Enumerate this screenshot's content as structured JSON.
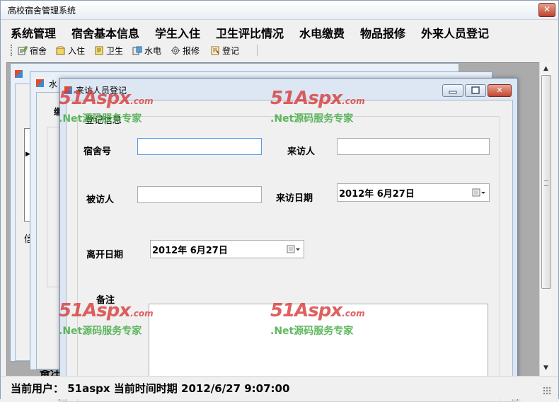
{
  "app": {
    "title": "高校宿舍管理系统",
    "close_glyph": "✕"
  },
  "menu": {
    "items": [
      {
        "label": "系统管理"
      },
      {
        "label": "宿舍基本信息"
      },
      {
        "label": "学生入住"
      },
      {
        "label": "卫生评比情况"
      },
      {
        "label": "水电缴费"
      },
      {
        "label": "物品报修"
      },
      {
        "label": "外来人员登记"
      }
    ]
  },
  "toolbar": {
    "items": [
      {
        "label": "宿舍",
        "icon": "dorm-icon"
      },
      {
        "label": "入住",
        "icon": "checkin-icon"
      },
      {
        "label": "卫生",
        "icon": "hygiene-icon"
      },
      {
        "label": "水电",
        "icon": "utility-icon"
      },
      {
        "label": "报修",
        "icon": "repair-icon"
      },
      {
        "label": "登记",
        "icon": "register-icon"
      }
    ]
  },
  "background_windows": {
    "water_title_partial": "水",
    "label_fee_partial": "缴",
    "label_info_partial": "信",
    "label_remark": "备注"
  },
  "visitor_form": {
    "title": "来访人员登记",
    "group_caption": "登记信息",
    "labels": {
      "dorm_no": "宿舍号",
      "visitor": "来访人",
      "visitee": "被访人",
      "visit_date": "来访日期",
      "leave_date": "离开日期",
      "remark": "备注"
    },
    "values": {
      "dorm_no": "",
      "visitor": "",
      "visitee": "",
      "visit_date": "2012年  6月27日",
      "leave_date": "2012年  6月27日",
      "remark": ""
    },
    "close_glyph": "✕"
  },
  "watermark": {
    "brand": "51Aspx",
    "domain": ".com",
    "tagline": ".Net源码服务专家"
  },
  "status": {
    "text": "当前用户：  51aspx  当前时间时期  2012/6/27 9:07:00"
  },
  "scrollbar": {
    "up": "▲",
    "down": "▼"
  },
  "colors": {
    "accent": "#569de5",
    "watermark_red": "#d63434",
    "watermark_green": "#3ea83e"
  }
}
